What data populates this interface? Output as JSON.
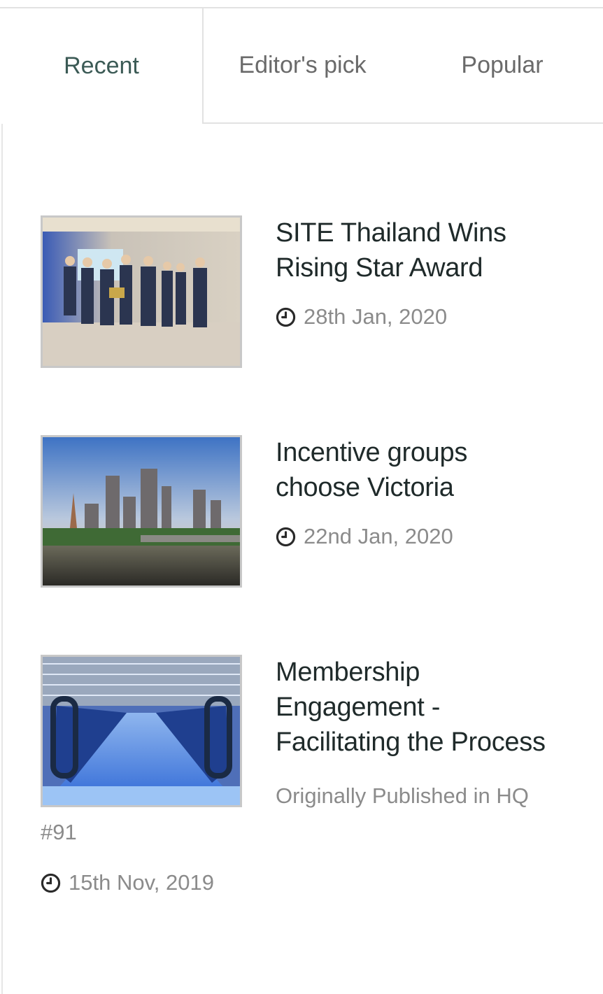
{
  "tabs": [
    {
      "label": "Recent",
      "active": true
    },
    {
      "label": "Editor's pick",
      "active": false
    },
    {
      "label": "Popular",
      "active": false
    }
  ],
  "posts": [
    {
      "title_line1": "SITE Thailand Wins",
      "title_line2": "Rising Star Award",
      "date": "28th Jan, 2020",
      "image": "award-group-photo"
    },
    {
      "title_line1": "Incentive groups",
      "title_line2": "choose Victoria",
      "date": "22nd Jan, 2020",
      "image": "melbourne-skyline-photo"
    },
    {
      "title_line1": "Membership",
      "title_line2": "Engagement -",
      "title_line3": "Facilitating the Process",
      "excerpt_line1": "Originally Published in HQ",
      "excerpt_line2": "#91",
      "date": "15th Nov, 2019",
      "image": "airport-walkway-photo"
    }
  ],
  "icons": {
    "date": "clock-icon"
  },
  "colors": {
    "active_tab_text": "#3b5a55",
    "tab_text": "#6a6a6a",
    "title_text": "#1f2a2a",
    "meta_text": "#8b8b8b",
    "border": "#e2e2e2"
  }
}
